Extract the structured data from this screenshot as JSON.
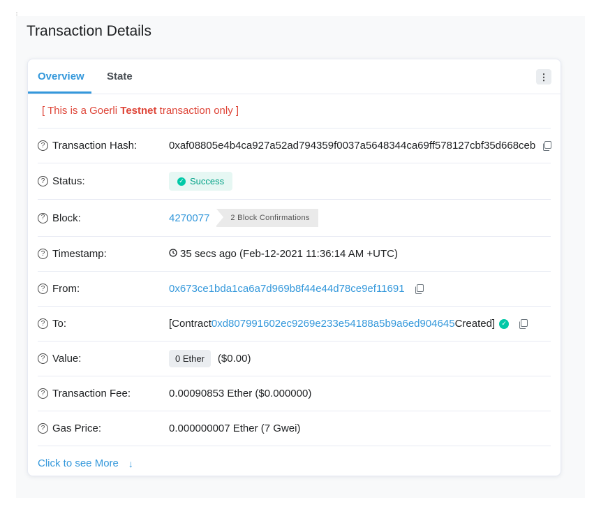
{
  "page": {
    "title": "Transaction Details"
  },
  "tabs": [
    {
      "label": "Overview"
    },
    {
      "label": "State"
    }
  ],
  "notice": {
    "prefix": "[ This is a Goerli ",
    "bold": "Testnet",
    "suffix": " transaction only ]"
  },
  "fields": {
    "tx_hash": {
      "label": "Transaction Hash:",
      "value": "0xaf08805e4b4ca927a52ad794359f0037a5648344ca69ff578127cbf35d668ceb"
    },
    "status": {
      "label": "Status:",
      "value": "Success"
    },
    "block": {
      "label": "Block:",
      "value": "4270077",
      "confirmations": "2 Block Confirmations"
    },
    "timestamp": {
      "label": "Timestamp:",
      "value": "35 secs ago (Feb-12-2021 11:36:14 AM +UTC)"
    },
    "from": {
      "label": "From:",
      "value": "0x673ce1bda1ca6a7d969b8f44e44d78ce9ef11691"
    },
    "to": {
      "label": "To:",
      "prefix": "[Contract ",
      "address": "0xd807991602ec9269e233e54188a5b9a6ed904645",
      "suffix": " Created]"
    },
    "value": {
      "label": "Value:",
      "badge": "0 Ether",
      "usd": "($0.00)"
    },
    "tx_fee": {
      "label": "Transaction Fee:",
      "value": "0.00090853 Ether ($0.000000)"
    },
    "gas_price": {
      "label": "Gas Price:",
      "value": "0.000000007 Ether (7 Gwei)"
    }
  },
  "see_more": {
    "label": "Click to see More"
  },
  "icons": {
    "help": "question-circle-icon",
    "copy": "copy-icon",
    "clock": "clock-icon",
    "check": "check-circle-icon",
    "more": "vertical-dots-icon",
    "arrow": "arrow-down-icon"
  },
  "colors": {
    "link": "#3498db",
    "success": "#00c9a7",
    "danger": "#de4437"
  }
}
